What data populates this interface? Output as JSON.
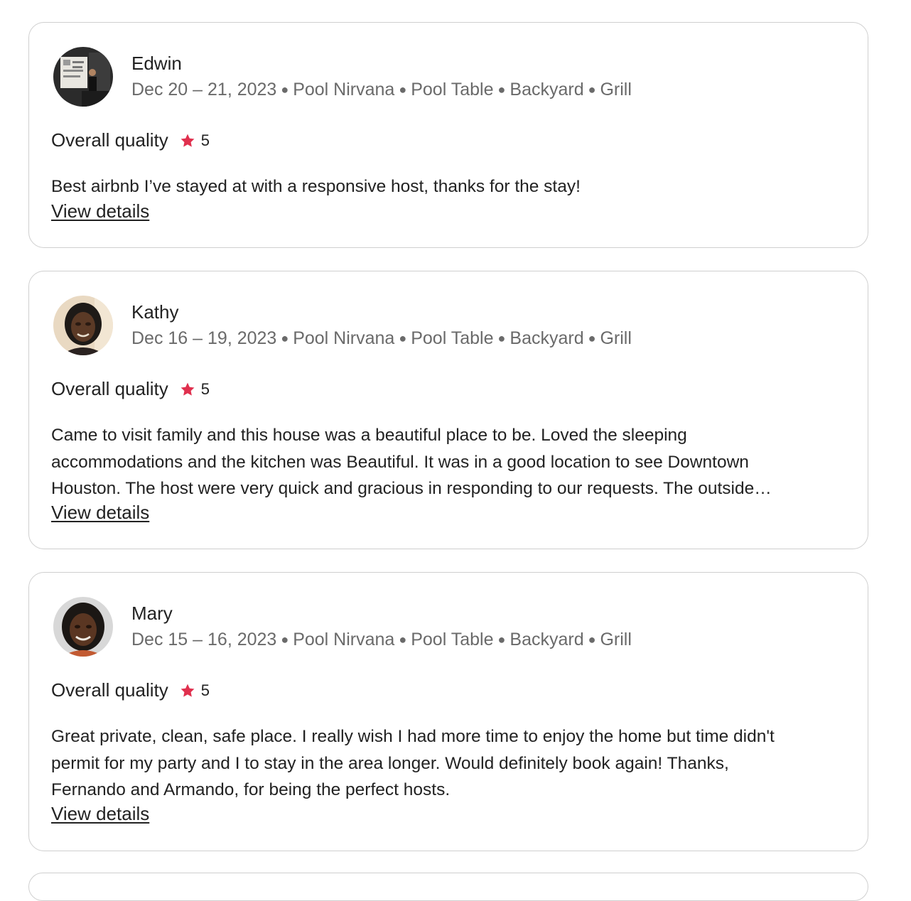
{
  "reviews": [
    {
      "name": "Edwin",
      "dates": "Dec 20 – 21, 2023",
      "tags": [
        "Pool Nirvana",
        "Pool Table",
        "Backyard",
        "Grill"
      ],
      "rating_label": "Overall quality",
      "rating": "5",
      "text_lines": [
        "Best airbnb I’ve stayed at with a responsive host, thanks for the stay!"
      ],
      "view_details": "View details",
      "avatar_icon": "guest-photo-edwin"
    },
    {
      "name": "Kathy",
      "dates": "Dec 16 – 19, 2023",
      "tags": [
        "Pool Nirvana",
        "Pool Table",
        "Backyard",
        "Grill"
      ],
      "rating_label": "Overall quality",
      "rating": "5",
      "text_lines": [
        "Came to visit family and this house was a beautiful place to be. Loved the sleeping",
        "accommodations and the kitchen was Beautiful. It was in a good location to see Downtown",
        "Houston. The host were very quick and gracious in responding to our requests. The outside…"
      ],
      "view_details": "View details",
      "avatar_icon": "guest-photo-kathy"
    },
    {
      "name": "Mary",
      "dates": "Dec 15 – 16, 2023",
      "tags": [
        "Pool Nirvana",
        "Pool Table",
        "Backyard",
        "Grill"
      ],
      "rating_label": "Overall quality",
      "rating": "5",
      "text_lines": [
        "Great private, clean, safe place. I really wish I had more time to enjoy the home but time didn't",
        "permit for my party and I to stay in the area longer. Would definitely book again! Thanks,",
        "Fernando and Armando, for being the perfect hosts."
      ],
      "view_details": "View details",
      "avatar_icon": "guest-photo-mary"
    }
  ],
  "colors": {
    "star": "#e0304e",
    "text": "#222222",
    "muted": "#6a6a6a",
    "border": "#cfcfcf"
  }
}
